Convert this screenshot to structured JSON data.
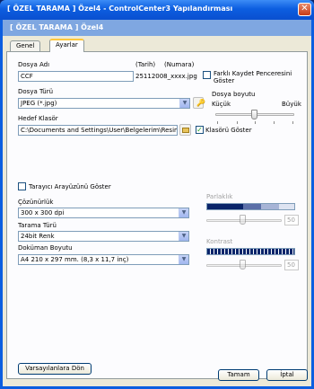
{
  "window": {
    "title": "[ ÖZEL TARAMA ]  Özel4 - ControlCenter3 Yapılandırması",
    "header": "[ ÖZEL TARAMA ]  Özel4",
    "close_glyph": "✕"
  },
  "tabs": [
    {
      "label": "Genel"
    },
    {
      "label": "Ayarlar"
    }
  ],
  "file": {
    "name_label": "Dosya Adı",
    "name_value": "CCF",
    "date_label": "(Tarih)",
    "number_label": "(Numara)",
    "preview_value": "25112008_xxxx.jpg",
    "save_as_label": "Farklı Kaydet Penceresini Göster",
    "save_as_checked": false,
    "type_label": "Dosya Türü",
    "type_value": "JPEG (*.jpg)",
    "size_label": "Dosya boyutu",
    "size_small": "Küçük",
    "size_large": "Büyük",
    "size_level": 0.5,
    "dest_label": "Hedef Klasör",
    "dest_value": "C:\\Documents and Settings\\User\\Belgelerim\\Resimlerim",
    "show_folder_label": "Klasörü Göster",
    "show_folder_checked": true
  },
  "scanner": {
    "show_ui_label": "Tarayıcı Arayüzünü Göster",
    "show_ui_checked": false,
    "resolution_label": "Çözünürlük",
    "resolution_value": "300 x 300 dpi",
    "scan_type_label": "Tarama Türü",
    "scan_type_value": "24bit Renk",
    "doc_size_label": "Doküman Boyutu",
    "doc_size_value": "A4 210 x 297 mm. (8,3 x 11,7 inç)",
    "brightness_label": "Parlaklık",
    "brightness_value": "50",
    "contrast_label": "Kontrast",
    "contrast_value": "50"
  },
  "buttons": {
    "defaults": "Varsayılanlara Dön",
    "ok": "Tamam",
    "cancel": "İptal"
  },
  "colors": {
    "title_bar": "#0c5ee0",
    "header_band": "#7fa7e1",
    "check_mark": "#21a121"
  }
}
